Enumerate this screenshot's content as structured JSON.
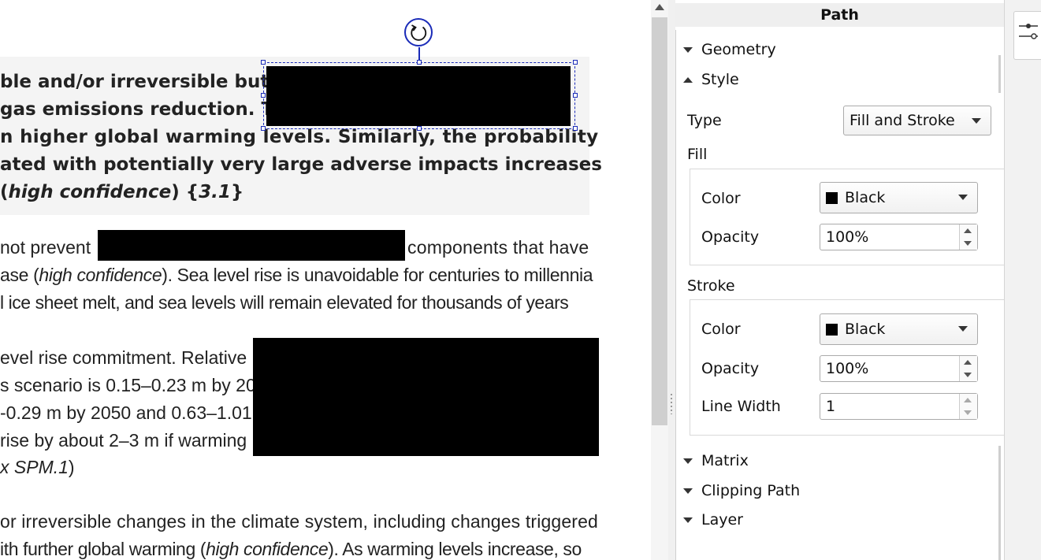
{
  "document": {
    "quote_lines": [
      "ble and/or irreversible but",
      "gas emissions reduction. T",
      "n higher global warming levels. Similarly, the probability",
      "ated with potentially very large adverse impacts increases",
      " (",
      "high confidence",
      ") {",
      "3.1",
      "}"
    ],
    "para1": {
      "line1_a": "not prevent",
      "line1_b": "components that have",
      "line2_a": "ase (",
      "line2_i": "high confidence",
      "line2_b": "). Sea level rise is unavoidable for centuries to millennia",
      "line3": "l ice sheet melt, and sea levels will remain elevated for thousands of years"
    },
    "para2": {
      "line1": "evel rise commitment. Relative",
      "line2": "s scenario is 0.15–0.23 m by 20",
      "line3": "-0.29 m by 2050 and 0.63–1.01",
      "line4": "rise by about 2–3 m if warming",
      "line5_i": "x SPM.1",
      "line5_b": ")"
    },
    "para3": {
      "line1": "or irreversible changes in the climate system, including changes triggered",
      "line2_a": "ith further global warming (",
      "line2_i": "high confidence",
      "line2_b": "). As warming levels increase, so"
    }
  },
  "panel": {
    "title": "Path",
    "sections": {
      "geometry": "Geometry",
      "style": "Style",
      "matrix": "Matrix",
      "clipping": "Clipping Path",
      "layer": "Layer"
    },
    "type_label": "Type",
    "type_value": "Fill and Stroke",
    "fill_label": "Fill",
    "fill": {
      "color_label": "Color",
      "color_value": "Black",
      "opacity_label": "Opacity",
      "opacity_value": "100%"
    },
    "stroke_label": "Stroke",
    "stroke": {
      "color_label": "Color",
      "color_value": "Black",
      "opacity_label": "Opacity",
      "opacity_value": "100%",
      "width_label": "Line Width",
      "width_value": "1"
    }
  },
  "icons": {
    "rotate": "rotate-icon",
    "properties_tab": "sliders-icon"
  },
  "colors": {
    "selection": "#1a2bb8",
    "redaction": "#000000",
    "quote_bg": "#f4f4f4"
  }
}
